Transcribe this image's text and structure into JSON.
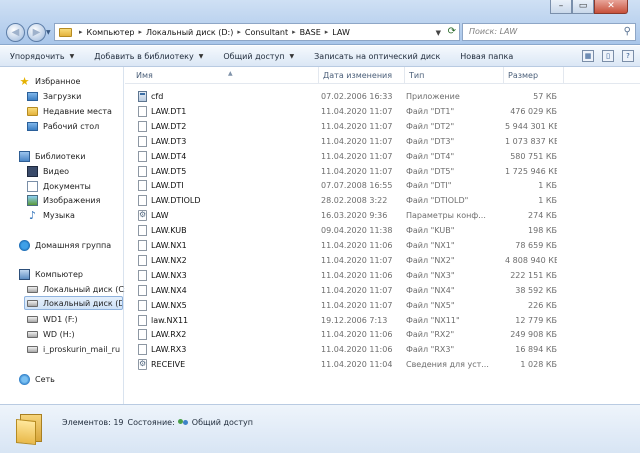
{
  "address": {
    "crumbs": [
      "Компьютер",
      "Локальный диск (D:)",
      "Consultant",
      "BASE",
      "LAW"
    ],
    "search_placeholder": "Поиск: LAW"
  },
  "toolbar": {
    "organize": "Упорядочить",
    "add_to_library": "Добавить в библиотеку",
    "share": "Общий доступ",
    "burn": "Записать на оптический диск",
    "new_folder": "Новая папка"
  },
  "nav": {
    "favorites": "Избранное",
    "downloads": "Загрузки",
    "recent": "Недавние места",
    "desktop": "Рабочий стол",
    "libraries": "Библиотеки",
    "video": "Видео",
    "documents": "Документы",
    "images": "Изображения",
    "music": "Музыка",
    "homegroup": "Домашняя группа",
    "computer": "Компьютер",
    "drive_c": "Локальный диск (C:)",
    "drive_d": "Локальный диск (D:)",
    "drive_f": "WD1 (F:)",
    "drive_h": "WD (H:)",
    "mail": "i_proskurin_mail_ru (\\",
    "network": "Сеть"
  },
  "columns": {
    "name": "Имя",
    "date": "Дата изменения",
    "type": "Тип",
    "size": "Размер"
  },
  "files": [
    {
      "name": "cfd",
      "date": "07.02.2006 16:33",
      "type": "Приложение",
      "size": "57 КБ",
      "icon": "application-icon"
    },
    {
      "name": "LAW.DT1",
      "date": "11.04.2020 11:07",
      "type": "Файл \"DT1\"",
      "size": "476 029 КБ",
      "icon": "file-icon"
    },
    {
      "name": "LAW.DT2",
      "date": "11.04.2020 11:07",
      "type": "Файл \"DT2\"",
      "size": "5 944 301 КБ",
      "icon": "file-icon"
    },
    {
      "name": "LAW.DT3",
      "date": "11.04.2020 11:07",
      "type": "Файл \"DT3\"",
      "size": "1 073 837 КБ",
      "icon": "file-icon"
    },
    {
      "name": "LAW.DT4",
      "date": "11.04.2020 11:07",
      "type": "Файл \"DT4\"",
      "size": "580 751 КБ",
      "icon": "file-icon"
    },
    {
      "name": "LAW.DT5",
      "date": "11.04.2020 11:07",
      "type": "Файл \"DT5\"",
      "size": "1 725 946 КБ",
      "icon": "file-icon"
    },
    {
      "name": "LAW.DTI",
      "date": "07.07.2008 16:55",
      "type": "Файл \"DTI\"",
      "size": "1 КБ",
      "icon": "file-icon"
    },
    {
      "name": "LAW.DTIOLD",
      "date": "28.02.2008 3:22",
      "type": "Файл \"DTIOLD\"",
      "size": "1 КБ",
      "icon": "file-icon"
    },
    {
      "name": "LAW",
      "date": "16.03.2020 9:36",
      "type": "Параметры конф...",
      "size": "274 КБ",
      "icon": "config-icon"
    },
    {
      "name": "LAW.KUB",
      "date": "09.04.2020 11:38",
      "type": "Файл \"KUB\"",
      "size": "198 КБ",
      "icon": "file-icon"
    },
    {
      "name": "LAW.NX1",
      "date": "11.04.2020 11:06",
      "type": "Файл \"NX1\"",
      "size": "78 659 КБ",
      "icon": "file-icon"
    },
    {
      "name": "LAW.NX2",
      "date": "11.04.2020 11:07",
      "type": "Файл \"NX2\"",
      "size": "4 808 940 КБ",
      "icon": "file-icon"
    },
    {
      "name": "LAW.NX3",
      "date": "11.04.2020 11:06",
      "type": "Файл \"NX3\"",
      "size": "222 151 КБ",
      "icon": "file-icon"
    },
    {
      "name": "LAW.NX4",
      "date": "11.04.2020 11:07",
      "type": "Файл \"NX4\"",
      "size": "38 592 КБ",
      "icon": "file-icon"
    },
    {
      "name": "LAW.NX5",
      "date": "11.04.2020 11:07",
      "type": "Файл \"NX5\"",
      "size": "226 КБ",
      "icon": "file-icon"
    },
    {
      "name": "law.NX11",
      "date": "19.12.2006 7:13",
      "type": "Файл \"NX11\"",
      "size": "12 779 КБ",
      "icon": "file-icon"
    },
    {
      "name": "LAW.RX2",
      "date": "11.04.2020 11:06",
      "type": "Файл \"RX2\"",
      "size": "249 908 КБ",
      "icon": "file-icon"
    },
    {
      "name": "LAW.RX3",
      "date": "11.04.2020 11:06",
      "type": "Файл \"RX3\"",
      "size": "16 894 КБ",
      "icon": "file-icon"
    },
    {
      "name": "RECEIVE",
      "date": "11.04.2020 11:04",
      "type": "Сведения для уст...",
      "size": "1 028 КБ",
      "icon": "config-icon"
    }
  ],
  "status": {
    "items_label": "Элементов: 19",
    "state_label": "Состояние:",
    "state_value": "Общий доступ"
  }
}
